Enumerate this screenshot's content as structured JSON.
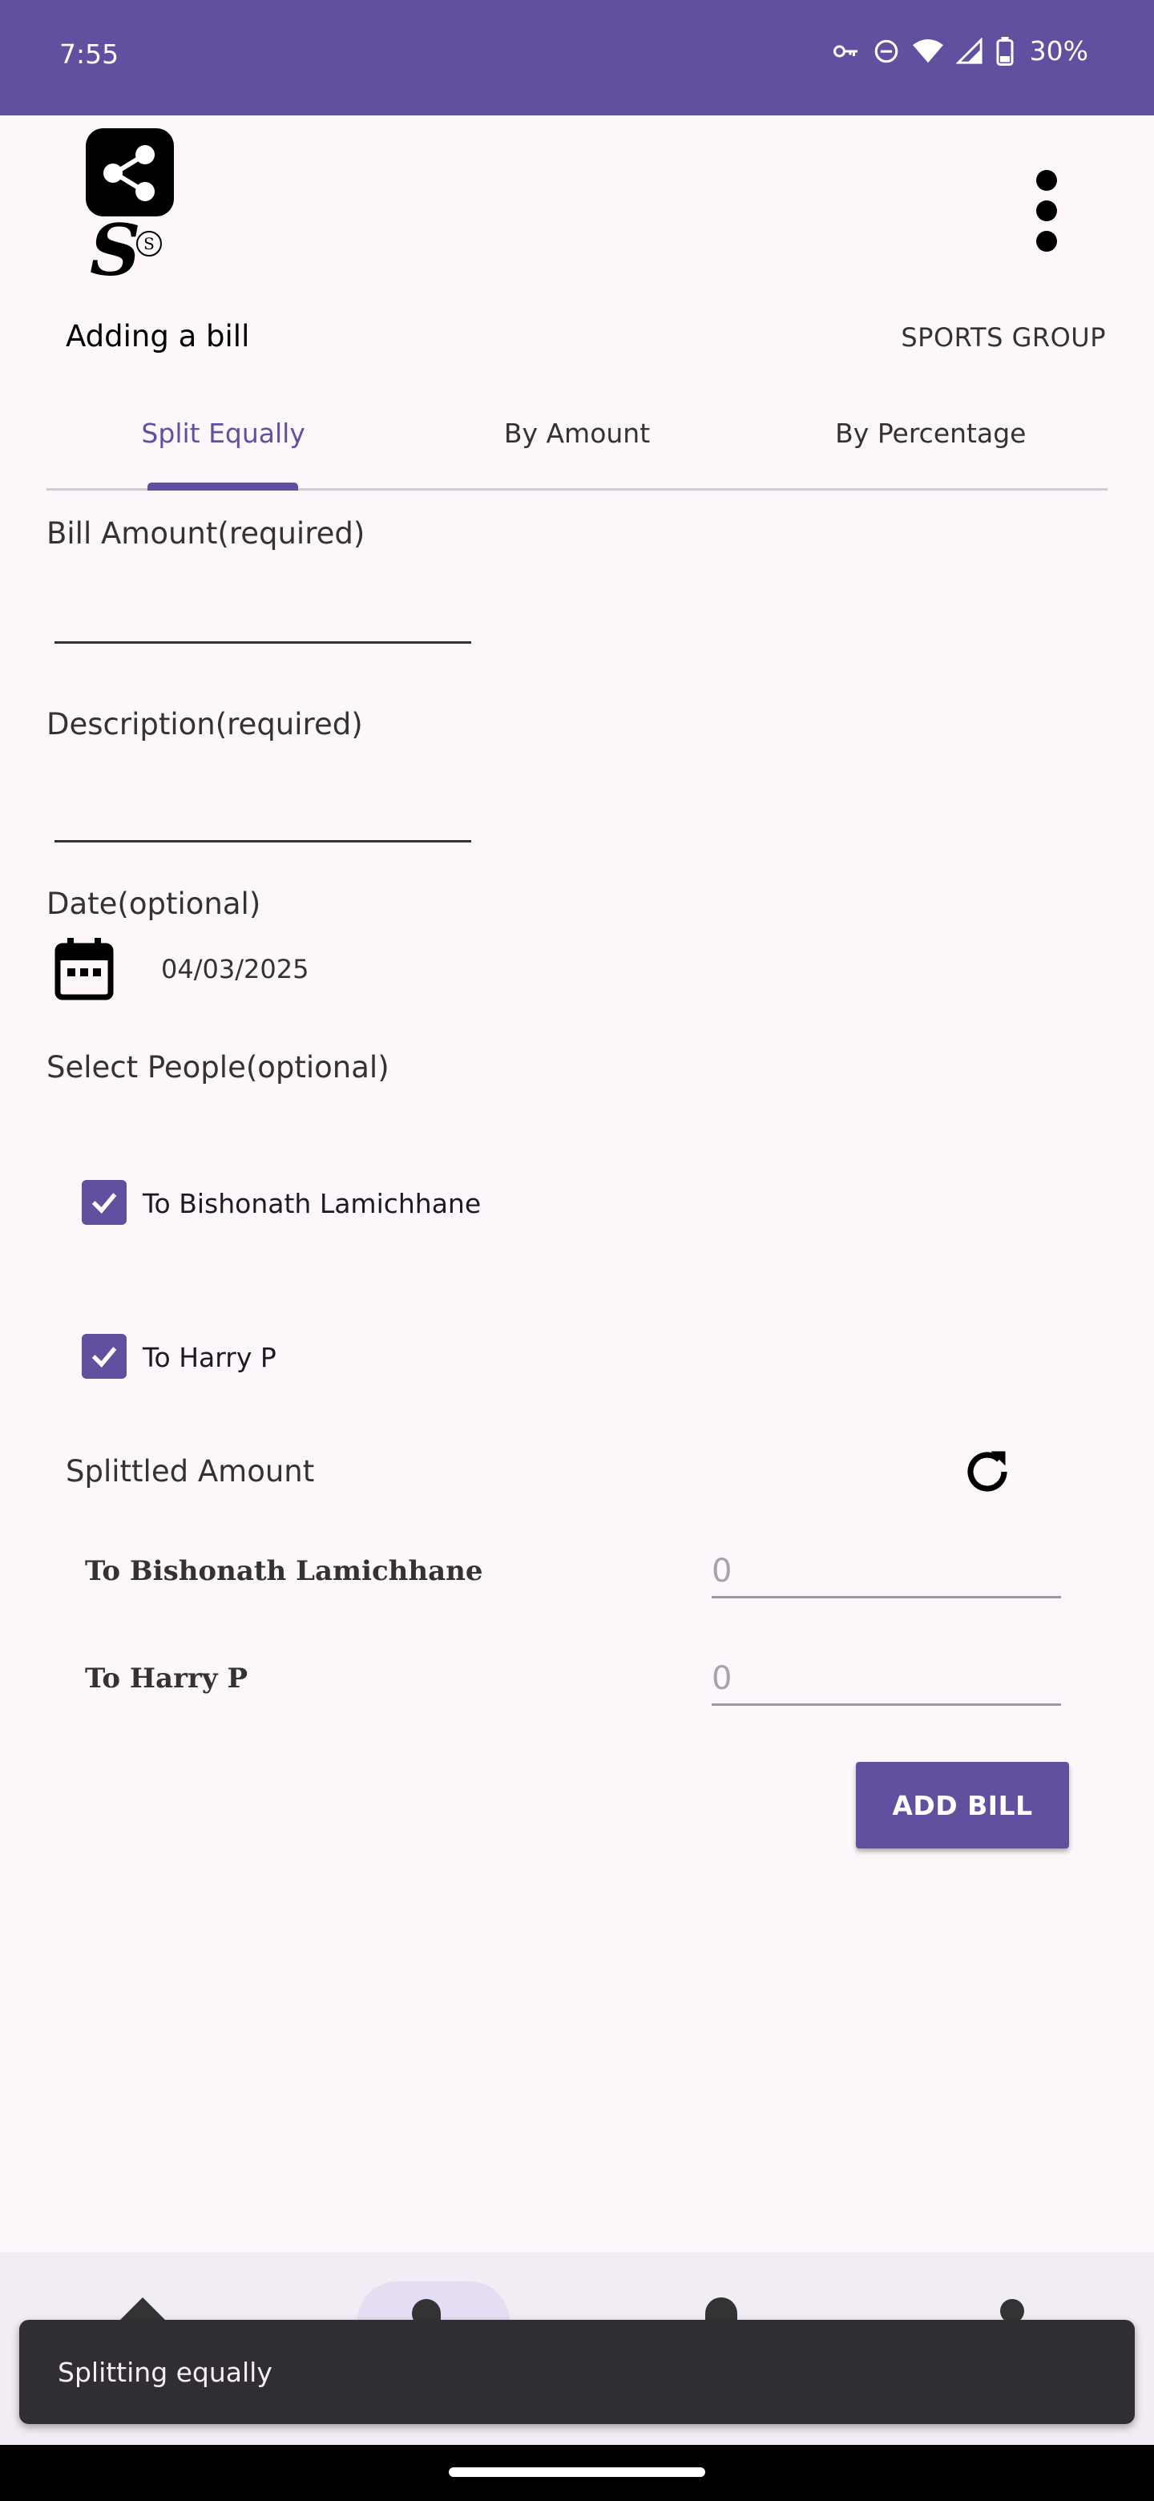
{
  "status_bar": {
    "time": "7:55",
    "battery": "30%",
    "icons": [
      "vpn-key-icon",
      "do-not-disturb-icon",
      "wifi-icon",
      "signal-icon",
      "battery-icon"
    ]
  },
  "header": {
    "logo_icon": "share-icon",
    "brand_letter": "S",
    "brand_mark": "S",
    "page_title": "Adding a bill",
    "group_name": "SPORTS GROUP",
    "menu_icon": "more-vertical-icon"
  },
  "tabs": [
    {
      "label": "Split Equally",
      "active": true
    },
    {
      "label": "By Amount",
      "active": false
    },
    {
      "label": "By Percentage",
      "active": false
    }
  ],
  "form": {
    "bill_amount_label": "Bill Amount(required)",
    "bill_amount_value": "",
    "description_label": "Description(required)",
    "description_value": "",
    "date_label": "Date(optional)",
    "date_icon": "calendar-icon",
    "date_value": "04/03/2025",
    "select_people_label": "Select People(optional)"
  },
  "people": [
    {
      "label": "To Bishonath Lamichhane",
      "checked": true
    },
    {
      "label": "To Harry P",
      "checked": true
    }
  ],
  "split": {
    "title": "Splittled Amount",
    "refresh_icon": "refresh-icon",
    "rows": [
      {
        "name": "To Bishonath Lamichhane",
        "placeholder": "0"
      },
      {
        "name": "To Harry P",
        "placeholder": "0"
      }
    ]
  },
  "actions": {
    "add_bill_label": "ADD BILL"
  },
  "snackbar": {
    "message": "Splitting equally"
  },
  "colors": {
    "primary": "#6150A0",
    "background": "#FDF7FC",
    "snackbar": "#302D34"
  }
}
